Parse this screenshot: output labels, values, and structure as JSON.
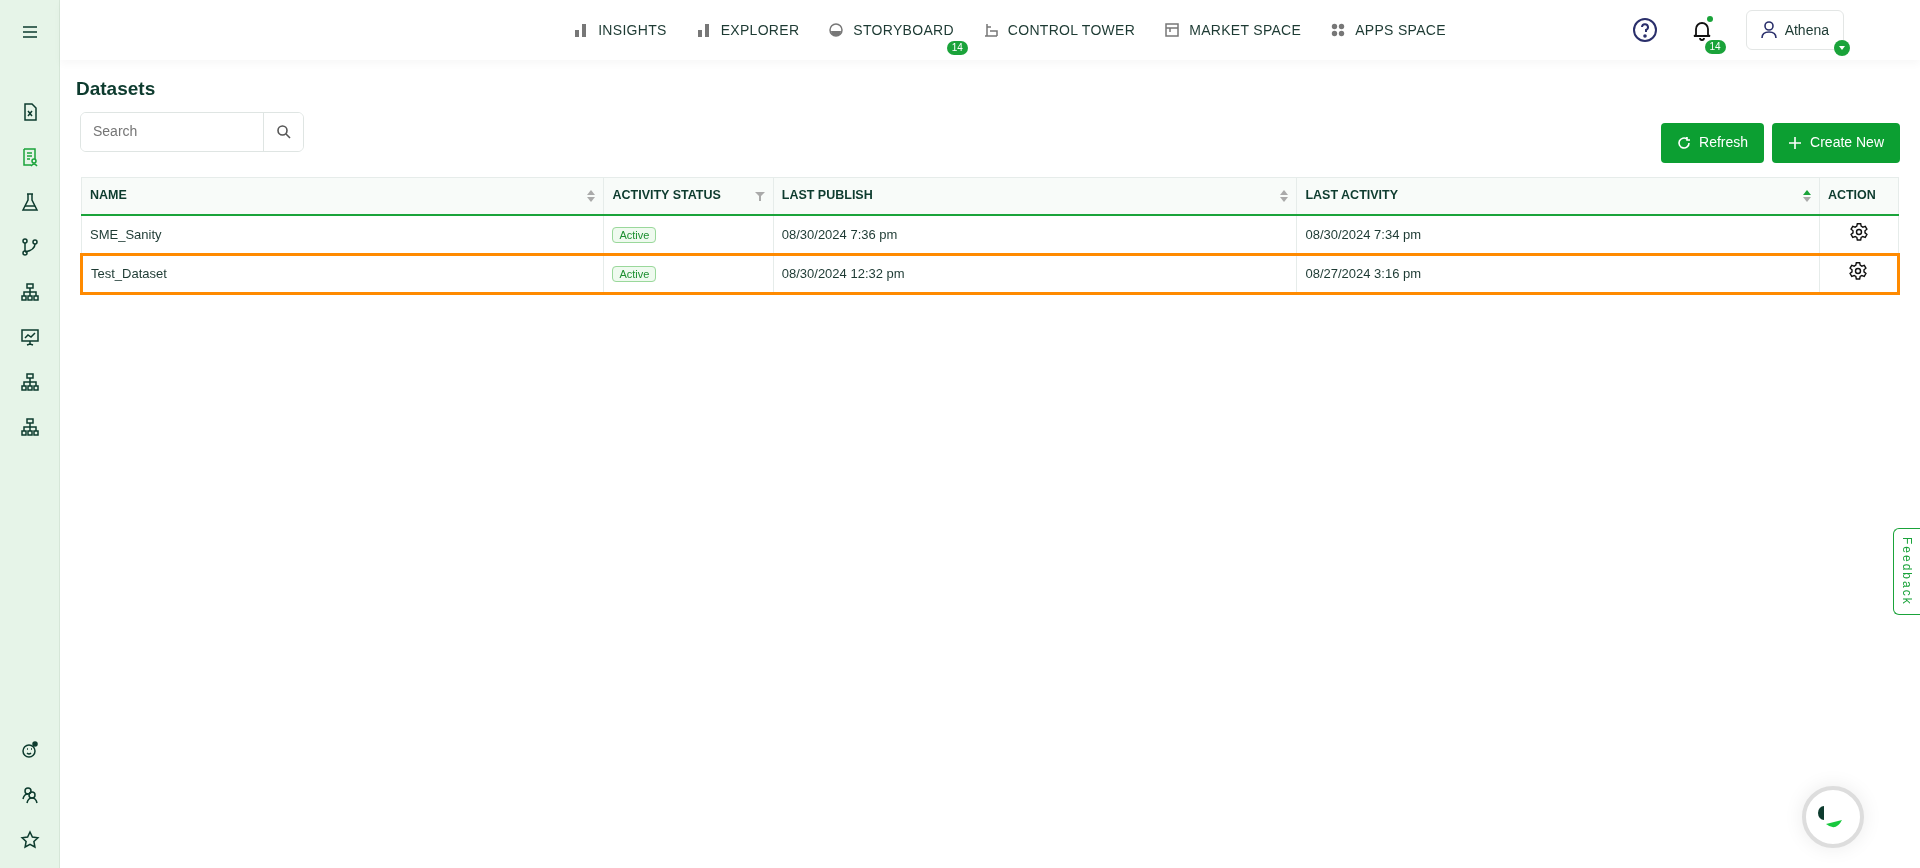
{
  "sidebar": {
    "items": [
      {
        "kind": "file",
        "selected": false
      },
      {
        "kind": "report",
        "selected": true
      },
      {
        "kind": "flask",
        "selected": false
      },
      {
        "kind": "branch",
        "selected": false
      },
      {
        "kind": "hierarchy",
        "selected": false
      },
      {
        "kind": "presentation",
        "selected": false
      },
      {
        "kind": "hierarchy",
        "selected": false
      },
      {
        "kind": "hierarchy",
        "selected": false
      }
    ],
    "bottom_items": [
      {
        "kind": "face",
        "selected": false
      },
      {
        "kind": "users",
        "selected": false
      },
      {
        "kind": "star",
        "selected": false
      }
    ]
  },
  "nav": {
    "items": [
      {
        "label": "INSIGHTS",
        "kind": "bars"
      },
      {
        "label": "EXPLORER",
        "kind": "bars"
      },
      {
        "label": "STORYBOARD",
        "kind": "gauge",
        "badge": "14"
      },
      {
        "label": "CONTROL TOWER",
        "kind": "tower"
      },
      {
        "label": "MARKET SPACE",
        "kind": "market"
      },
      {
        "label": "APPS SPACE",
        "kind": "apps"
      }
    ],
    "notifications_badge": "14",
    "user": "Athena"
  },
  "page_title": "Datasets",
  "search": {
    "placeholder": "Search"
  },
  "buttons": [
    {
      "label": "Refresh",
      "kind": "refresh"
    },
    {
      "label": "Create New",
      "kind": "plus"
    }
  ],
  "table": {
    "columns": [
      {
        "label": "NAME",
        "sortable": true,
        "sorted_ascending": false,
        "filterable": false
      },
      {
        "label": "ACTIVITY STATUS",
        "sortable": false,
        "sorted_ascending": false,
        "filterable": true
      },
      {
        "label": "LAST PUBLISH",
        "sortable": true,
        "sorted_ascending": false,
        "filterable": false
      },
      {
        "label": "LAST ACTIVITY",
        "sortable": true,
        "sorted_ascending": true,
        "filterable": false
      },
      {
        "label": "ACTION",
        "sortable": false,
        "sorted_ascending": false,
        "filterable": false
      }
    ],
    "rows": [
      {
        "name": "SME_Sanity",
        "status": "Active",
        "last_publish": "08/30/2024 7:36 pm",
        "last_activity": "08/30/2024 7:34 pm",
        "selected": false
      },
      {
        "name": "Test_Dataset",
        "status": "Active",
        "last_publish": "08/30/2024 12:32 pm",
        "last_activity": "08/27/2024 3:16 pm",
        "selected": true
      }
    ]
  },
  "feedback": "Feedback"
}
